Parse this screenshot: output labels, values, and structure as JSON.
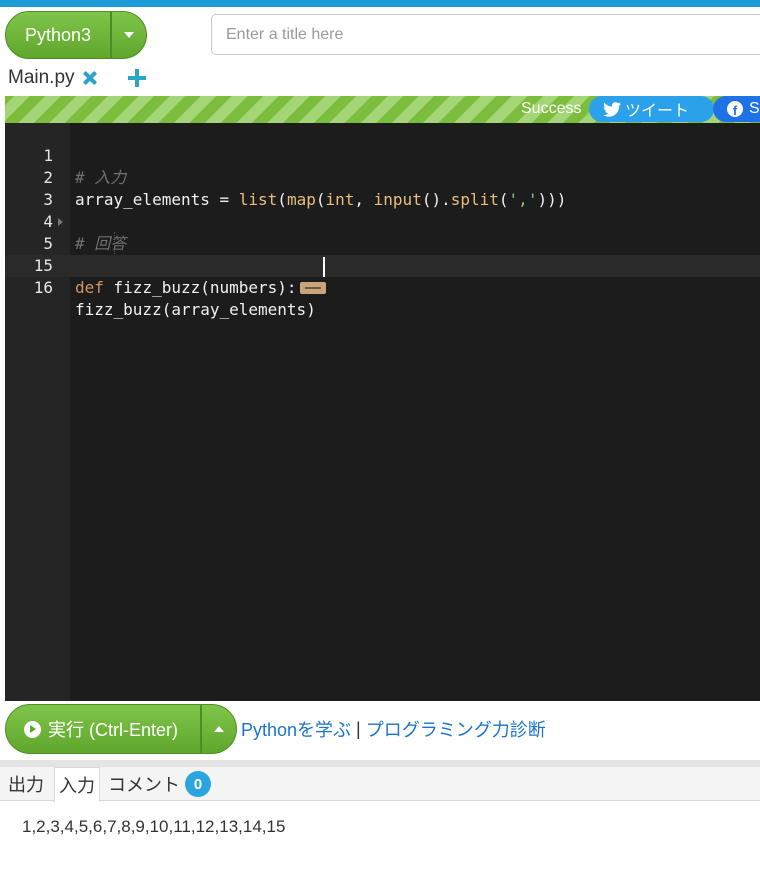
{
  "header": {
    "language_label": "Python3",
    "title_placeholder": "Enter a title here"
  },
  "tabs": {
    "file_name": "Main.py"
  },
  "status": {
    "text": "Success",
    "tweet_label": "ツイート",
    "share_label": "Sh"
  },
  "editor": {
    "lines": [
      {
        "num": "1",
        "text": "# 入力"
      },
      {
        "num": "2",
        "text": "array_elements = list(map(int, input().split(',')))"
      },
      {
        "num": "3",
        "text": ""
      },
      {
        "num": "4",
        "text": "# 回答"
      },
      {
        "num": "5",
        "text": "def fizz_buzz(numbers):"
      },
      {
        "num": "15",
        "text": ""
      },
      {
        "num": "16",
        "text": "fizz_buzz(array_elements)"
      }
    ],
    "tokens": {
      "l1_comment": "# 入力",
      "l2_var": "array_elements = ",
      "l2_list": "list",
      "l2_p1": "(",
      "l2_map": "map",
      "l2_p2": "(",
      "l2_int": "int",
      "l2_comma": ", ",
      "l2_input": "input",
      "l2_dot": "().",
      "l2_split": "split",
      "l2_p3": "(",
      "l2_str": "','",
      "l2_close": ")))",
      "l4_comment": "# 回答",
      "l5_def": "def",
      "l5_rest": " fizz_buzz(numbers):",
      "l16": "fizz_buzz(array_elements)"
    }
  },
  "run": {
    "run_label": "実行 (Ctrl-Enter)",
    "link_learn": "Pythonを学ぶ",
    "separator": "|",
    "link_diagnose": "プログラミング力診断"
  },
  "output": {
    "tab_output": "出力",
    "tab_input": "入力",
    "tab_comment": "コメント",
    "comment_count": "0",
    "input_value": "1,2,3,4,5,6,7,8,9,10,11,12,13,14,15"
  },
  "colors": {
    "green": "#6ab237",
    "blue_link": "#1b74c9",
    "twitter": "#2ba1ec",
    "facebook": "#1e72e6",
    "editor_bg": "#1c1c1c"
  }
}
